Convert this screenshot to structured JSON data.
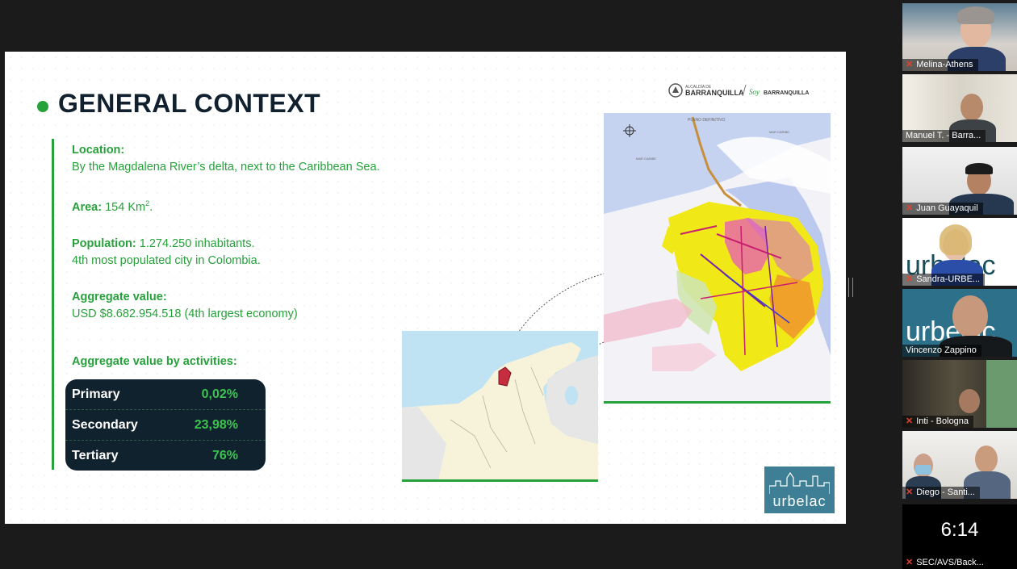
{
  "slide": {
    "title": "GENERAL CONTEXT",
    "location_label": "Location:",
    "location_text": "By the Magdalena River’s delta, next to the Caribbean Sea.",
    "area_label": "Area:",
    "area_text": " 154 Km",
    "area_sup": "2",
    "area_end": ".",
    "population_label": "Population:",
    "population_text": " 1.274.250 inhabitants.",
    "population_note": "4th most populated city in Colombia.",
    "aggregate_label": "Aggregate value:",
    "aggregate_text": "USD $8.682.954.518 (4th largest economy)",
    "activities_label": "Aggregate value by activities:",
    "activities": [
      {
        "name": "Primary",
        "value": "0,02%"
      },
      {
        "name": "Secondary",
        "value": "23,98%"
      },
      {
        "name": "Tertiary",
        "value": "76%"
      }
    ],
    "logo_small": "ALCALDÍA DE",
    "logo_big": "BARRANQUILLA",
    "logo_soy": "Soy",
    "logo_right": "BARRANQUILLA",
    "map_label": "PLANO DEFINITIVO",
    "map_sea_left": "MAR CARIBE",
    "map_sea_right": "MAR CARIBE",
    "badge_text": "urbelac"
  },
  "participants": [
    {
      "name": "Melina-Athens"
    },
    {
      "name": "Manuel T. - Barra..."
    },
    {
      "name": "Juan Guayaquil"
    },
    {
      "name": "Sandra-URBE..."
    },
    {
      "name": "Vincenzo Zappino"
    },
    {
      "name": "Inti - Bologna"
    },
    {
      "name": "Diego - Santi..."
    }
  ],
  "timer": {
    "time": "6:14",
    "name": "SEC/AVS/Back..."
  },
  "colors": {
    "accent_green": "#27a13b",
    "table_bg": "#11222f",
    "active_border": "#e6d75a",
    "muted_mic": "#e8412f"
  }
}
